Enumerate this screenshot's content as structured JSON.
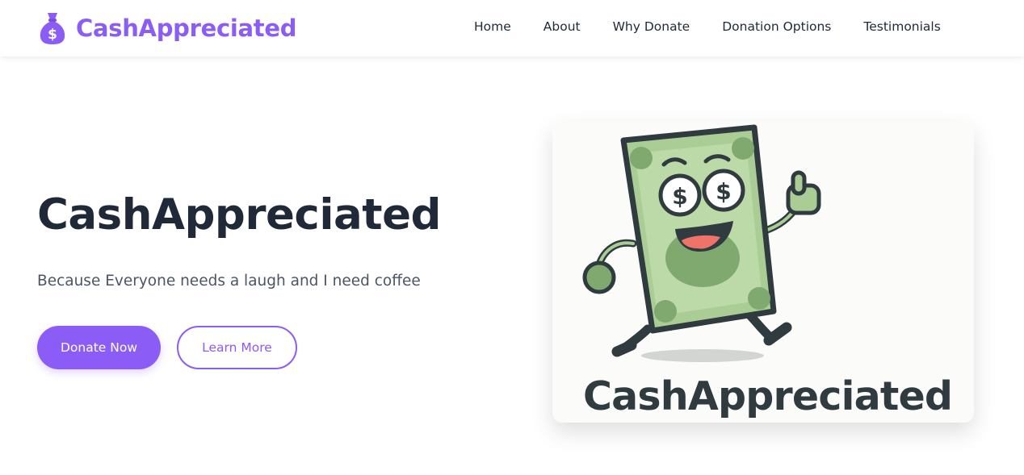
{
  "colors": {
    "accent": "#8b5cf6",
    "text_dark": "#1f2937",
    "text_muted": "#4b5563",
    "bill_green": "#a9cd94",
    "bill_outline": "#2f3b3f"
  },
  "nav": {
    "brand_icon": "money-bag-icon",
    "brand_name": "CashAppreciated",
    "links": [
      "Home",
      "About",
      "Why Donate",
      "Donation Options",
      "Testimonials"
    ]
  },
  "hero": {
    "title": "CashAppreciated",
    "subtitle": "Because Everyone needs a laugh and I need coffee",
    "primary_button": "Donate Now",
    "secondary_button": "Learn More",
    "image": {
      "subject": "money-bill-mascot",
      "wordmark": "CashAppreciated"
    }
  }
}
